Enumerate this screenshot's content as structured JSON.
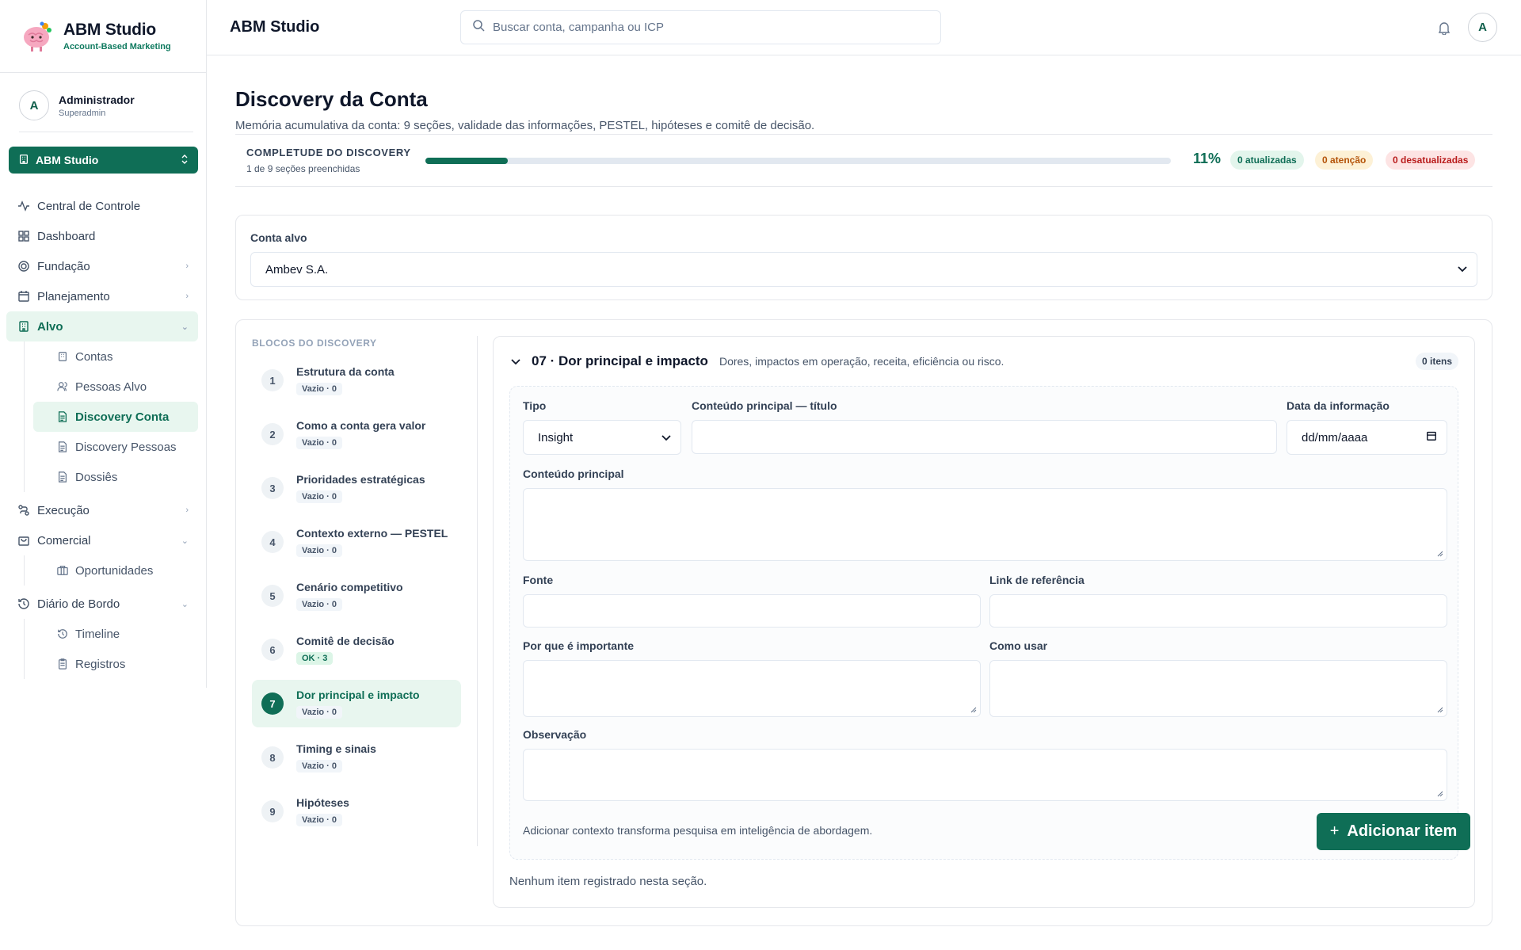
{
  "brand": {
    "name": "ABM Studio",
    "tagline": "Account-Based Marketing"
  },
  "user": {
    "initial": "A",
    "name": "Administrador",
    "role": "Superadmin"
  },
  "workspace": {
    "label": "ABM Studio"
  },
  "nav": {
    "central": "Central de Controle",
    "dashboard": "Dashboard",
    "fundacao": "Fundação",
    "planejamento": "Planejamento",
    "alvo": "Alvo",
    "contas": "Contas",
    "pessoas_alvo": "Pessoas Alvo",
    "discovery_conta": "Discovery Conta",
    "discovery_pessoas": "Discovery Pessoas",
    "dossies": "Dossiês",
    "execucao": "Execução",
    "comercial": "Comercial",
    "oportunidades": "Oportunidades",
    "diario": "Diário de Bordo",
    "timeline": "Timeline",
    "registros": "Registros"
  },
  "topbar": {
    "title": "ABM Studio",
    "search_placeholder": "Buscar conta, campanha ou ICP",
    "avatar": "A"
  },
  "page": {
    "title": "Discovery da Conta",
    "subtitle": "Memória acumulativa da conta: 9 seções, validade das informações, PESTEL, hipóteses e comitê de decisão."
  },
  "completude": {
    "title": "COMPLETUDE DO DISCOVERY",
    "subtitle": "1 de 9 seções preenchidas",
    "progress": 0.11,
    "percent_label": "11%",
    "badge_updated": "0 atualizadas",
    "badge_attention": "0 atenção",
    "badge_outdated": "0 desatualizadas"
  },
  "conta": {
    "label": "Conta alvo",
    "value": "Ambev S.A."
  },
  "blocks": {
    "header": "BLOCOS DO DISCOVERY",
    "items": [
      {
        "num": "1",
        "name": "Estrutura da conta",
        "status": "Vazio · 0"
      },
      {
        "num": "2",
        "name": "Como a conta gera valor",
        "status": "Vazio · 0"
      },
      {
        "num": "3",
        "name": "Prioridades estratégicas",
        "status": "Vazio · 0"
      },
      {
        "num": "4",
        "name": "Contexto externo — PESTEL",
        "status": "Vazio · 0"
      },
      {
        "num": "5",
        "name": "Cenário competitivo",
        "status": "Vazio · 0"
      },
      {
        "num": "6",
        "name": "Comitê de decisão",
        "status": "OK · 3"
      },
      {
        "num": "7",
        "name": "Dor principal e impacto",
        "status": "Vazio · 0"
      },
      {
        "num": "8",
        "name": "Timing e sinais",
        "status": "Vazio · 0"
      },
      {
        "num": "9",
        "name": "Hipóteses",
        "status": "Vazio · 0"
      }
    ]
  },
  "section": {
    "title": "07 · Dor principal e impacto",
    "description": "Dores, impactos em operação, receita, eficiência ou risco.",
    "count": "0 itens",
    "form": {
      "tipo_label": "Tipo",
      "tipo_value": "Insight",
      "titulo_label": "Conteúdo principal — título",
      "data_label": "Data da informação",
      "data_placeholder": "dd/mm/aaaa",
      "conteudo_label": "Conteúdo principal",
      "fonte_label": "Fonte",
      "link_label": "Link de referência",
      "porque_label": "Por que é importante",
      "como_label": "Como usar",
      "obs_label": "Observação",
      "hint": "Adicionar contexto transforma pesquisa em inteligência de abordagem.",
      "add_button": "Adicionar item",
      "add_button_icon": "+"
    },
    "empty": "Nenhum item registrado nesta seção."
  },
  "colors": {
    "accent": "#0f6e56",
    "accent_light": "#e8f6ef",
    "warn": "#b45309",
    "danger": "#b91c1c"
  }
}
